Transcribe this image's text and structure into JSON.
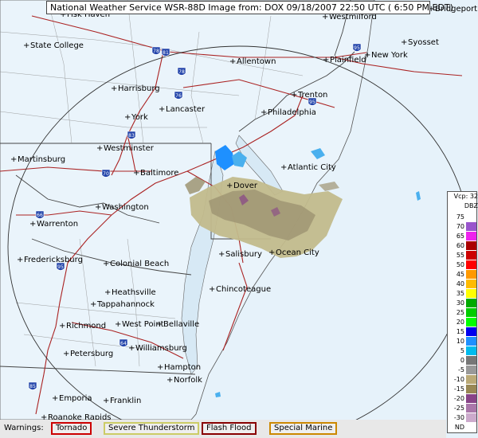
{
  "title_bar": {
    "text": "National Weather Service WSR-88D Image from: DOX 09/18/2007 22:50 UTC ( 6:50 PM EDT)"
  },
  "legend": {
    "header": "Vcp: 32",
    "units": "DBZ",
    "items": [
      {
        "label": "75",
        "color": "#ffffff"
      },
      {
        "label": "70",
        "color": "#9955cc"
      },
      {
        "label": "65",
        "color": "#ee22ee"
      },
      {
        "label": "60",
        "color": "#aa0000"
      },
      {
        "label": "55",
        "color": "#cc0000"
      },
      {
        "label": "50",
        "color": "#ff0000"
      },
      {
        "label": "45",
        "color": "#ff9900"
      },
      {
        "label": "40",
        "color": "#ffbb00"
      },
      {
        "label": "35",
        "color": "#ffff00"
      },
      {
        "label": "30",
        "color": "#00aa00"
      },
      {
        "label": "25",
        "color": "#00cc00"
      },
      {
        "label": "20",
        "color": "#00ff00"
      },
      {
        "label": "15",
        "color": "#0000ee"
      },
      {
        "label": "10",
        "color": "#1e90ff"
      },
      {
        "label": "5",
        "color": "#00bbee"
      },
      {
        "label": "0",
        "color": "#777777"
      },
      {
        "label": "-5",
        "color": "#999999"
      },
      {
        "label": "-10",
        "color": "#bbaa77"
      },
      {
        "label": "-15",
        "color": "#998855"
      },
      {
        "label": "-20",
        "color": "#884488"
      },
      {
        "label": "-25",
        "color": "#aa77aa"
      },
      {
        "label": "-30",
        "color": "#ccaacc"
      },
      {
        "label": "ND",
        "color": "#ffffff"
      }
    ]
  },
  "warnings": {
    "label": "Warnings:",
    "items": [
      {
        "label": "Tornado",
        "color": "#cc0000"
      },
      {
        "label": "Severe Thunderstorm",
        "color": "#cccc66"
      },
      {
        "label": "Flash Flood",
        "color": "#880000"
      },
      {
        "label": "Special Marine",
        "color": "#cc8800"
      }
    ]
  },
  "map": {
    "cities": [
      "Fisk Haven",
      "Westmilford",
      "Bridgeport",
      "State College",
      "Allentown",
      "Plainfield",
      "New York",
      "Syosset",
      "Harrisburg",
      "Trenton",
      "Lancaster",
      "Philadelphia",
      "York",
      "Westminster",
      "Atlantic City",
      "Martinsburg",
      "Baltimore",
      "Dover",
      "Washington",
      "Warrenton",
      "Salisbury",
      "Ocean City",
      "Fredericksburg",
      "Colonial Beach",
      "Chincoteague",
      "Heathsville",
      "Tappahannock",
      "West Point",
      "Bellaville",
      "Richmond",
      "Williamsburg",
      "Petersburg",
      "Hampton",
      "Norfolk",
      "Emporia",
      "Franklin",
      "Roanoke Rapids"
    ],
    "interstates": [
      "81",
      "78",
      "76",
      "95",
      "83",
      "70",
      "66",
      "95",
      "64",
      "85",
      "95",
      "78"
    ]
  }
}
